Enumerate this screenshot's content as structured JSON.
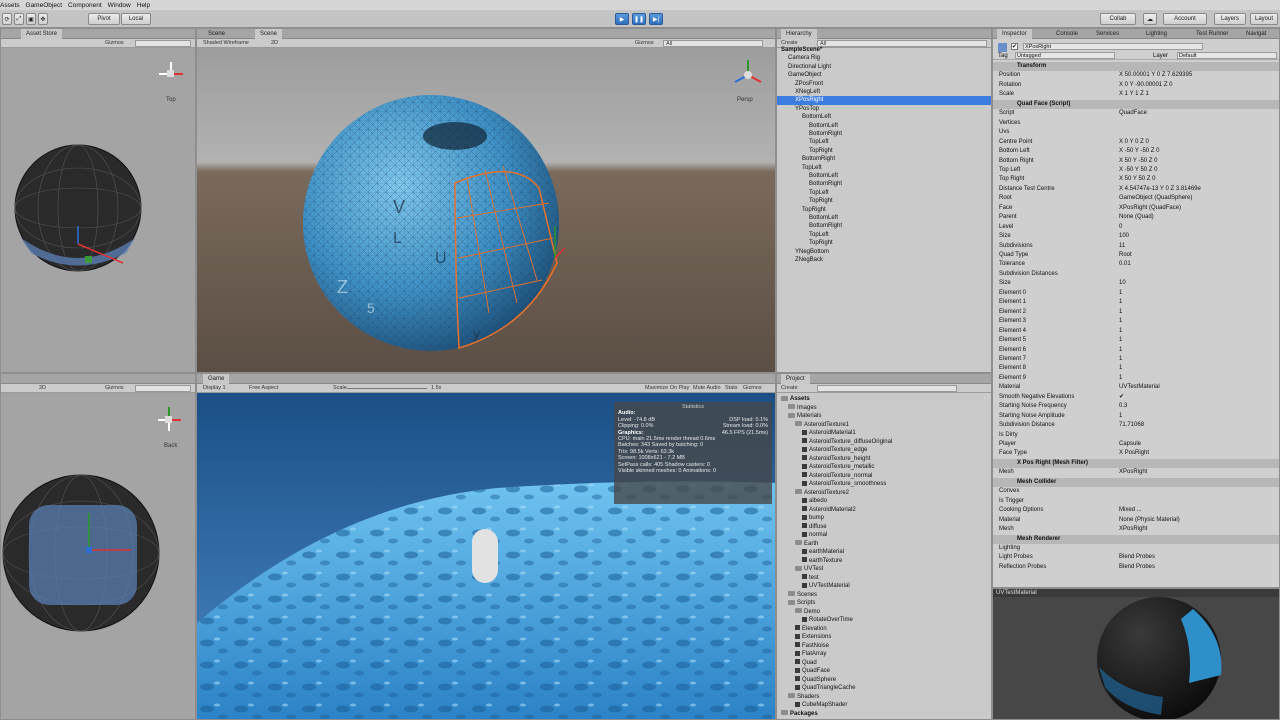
{
  "menu": [
    "Assets",
    "GameObject",
    "Component",
    "Window",
    "Help"
  ],
  "toolbar": {
    "pivot": "Pivot",
    "local": "Local",
    "collab": "Collab",
    "account": "Account",
    "layers": "Layers",
    "layout": "Layout"
  },
  "scene_left_top": {
    "tab": "Asset Store",
    "tab2": "",
    "gizmos": "Gizmos",
    "search": "",
    "orient": "Top"
  },
  "scene_main": {
    "tab1": "Scene",
    "tab2": "Scene",
    "shading": "Shaded Wireframe",
    "mode": "2D",
    "gizmos": "Gizmos",
    "search": "All",
    "persp": "Persp",
    "labels": [
      "V",
      "L",
      "U",
      "Z",
      "5",
      "y"
    ]
  },
  "scene_left_bottom": {
    "mode": "2D",
    "gizmos": "Gizmos",
    "orient": "Back"
  },
  "game": {
    "tab": "Game",
    "display": "Display 1",
    "aspect": "Free Aspect",
    "scale_label": "Scale",
    "scale_value": "1.5x",
    "maximize": "Maximize On Play",
    "mute": "Mute Audio",
    "stats": "Stats",
    "gizmos": "Gizmos"
  },
  "statistics": {
    "title": "Statistics",
    "audio_h": "Audio:",
    "level": "Level: -74.8 dB",
    "dsp": "DSP load: 0.1%",
    "clipping": "Clipping: 0.0%",
    "stream": "Stream load: 0.0%",
    "graphics_h": "Graphics:",
    "fps": "46.5 FPS (21.5ms)",
    "cpu": "CPU: main 21.5ms  render thread 0.6ms",
    "batches": "Batches: 343    Saved by batching: 0",
    "tris": "Tris: 98.5k     Verts: 63.3k",
    "screen": "Screen: 1008x621 - 7.2 MB",
    "setpass": "SetPass calls: 405   Shadow casters: 0",
    "skinned": "Visible skinned meshes: 0  Animations: 0"
  },
  "hierarchy": {
    "tab": "Hierarchy",
    "create": "Create",
    "search": "All",
    "items": [
      {
        "label": "SampleScene*",
        "indent": 0,
        "bold": true
      },
      {
        "label": "Camera Rig",
        "indent": 1
      },
      {
        "label": "Directional Light",
        "indent": 1
      },
      {
        "label": "GameObject",
        "indent": 1
      },
      {
        "label": "ZPosFront",
        "indent": 2
      },
      {
        "label": "XNegLeft",
        "indent": 2
      },
      {
        "label": "XPosRight",
        "indent": 2,
        "selected": true
      },
      {
        "label": "YPosTop",
        "indent": 2
      },
      {
        "label": "BottomLeft",
        "indent": 3
      },
      {
        "label": "BottomLeft",
        "indent": 4
      },
      {
        "label": "BottomRight",
        "indent": 4
      },
      {
        "label": "TopLeft",
        "indent": 4
      },
      {
        "label": "TopRight",
        "indent": 4
      },
      {
        "label": "BottomRight",
        "indent": 3
      },
      {
        "label": "TopLeft",
        "indent": 3
      },
      {
        "label": "BottomLeft",
        "indent": 4
      },
      {
        "label": "BottomRight",
        "indent": 4
      },
      {
        "label": "TopLeft",
        "indent": 4
      },
      {
        "label": "TopRight",
        "indent": 4
      },
      {
        "label": "TopRight",
        "indent": 3
      },
      {
        "label": "BottomLeft",
        "indent": 4
      },
      {
        "label": "BottomRight",
        "indent": 4
      },
      {
        "label": "TopLeft",
        "indent": 4
      },
      {
        "label": "TopRight",
        "indent": 4
      },
      {
        "label": "YNegBottom",
        "indent": 2
      },
      {
        "label": "ZNegBack",
        "indent": 2
      }
    ]
  },
  "project": {
    "tab": "Project",
    "create": "Create",
    "items": [
      {
        "label": "Assets",
        "indent": 0,
        "folder": true,
        "bold": true
      },
      {
        "label": "Images",
        "indent": 1,
        "folder": true
      },
      {
        "label": "Materials",
        "indent": 1,
        "folder": true
      },
      {
        "label": "AsteroidTexture1",
        "indent": 2,
        "folder": true
      },
      {
        "label": "AsteroidMaterial1",
        "indent": 3
      },
      {
        "label": "AsteroidTexture_diffuseOriginal",
        "indent": 3
      },
      {
        "label": "AsteroidTexture_edge",
        "indent": 3
      },
      {
        "label": "AsteroidTexture_height",
        "indent": 3
      },
      {
        "label": "AsteroidTexture_metallic",
        "indent": 3
      },
      {
        "label": "AsteroidTexture_normal",
        "indent": 3
      },
      {
        "label": "AsteroidTexture_smoothness",
        "indent": 3
      },
      {
        "label": "AsteroidTexture2",
        "indent": 2,
        "folder": true
      },
      {
        "label": "albedo",
        "indent": 3
      },
      {
        "label": "AsteroidMaterial2",
        "indent": 3
      },
      {
        "label": "bump",
        "indent": 3
      },
      {
        "label": "diffuse",
        "indent": 3
      },
      {
        "label": "normal",
        "indent": 3
      },
      {
        "label": "Earth",
        "indent": 2,
        "folder": true
      },
      {
        "label": "earthMaterial",
        "indent": 3
      },
      {
        "label": "earthTexture",
        "indent": 3
      },
      {
        "label": "UVTest",
        "indent": 2,
        "folder": true
      },
      {
        "label": "test",
        "indent": 3
      },
      {
        "label": "UVTestMaterial",
        "indent": 3
      },
      {
        "label": "Scenes",
        "indent": 1,
        "folder": true
      },
      {
        "label": "Scripts",
        "indent": 1,
        "folder": true
      },
      {
        "label": "Demo",
        "indent": 2,
        "folder": true
      },
      {
        "label": "RotateOverTime",
        "indent": 3
      },
      {
        "label": "Elevation",
        "indent": 2
      },
      {
        "label": "Extensions",
        "indent": 2
      },
      {
        "label": "FastNoise",
        "indent": 2
      },
      {
        "label": "FlatArray",
        "indent": 2
      },
      {
        "label": "Quad",
        "indent": 2
      },
      {
        "label": "QuadFace",
        "indent": 2
      },
      {
        "label": "QuadSphere",
        "indent": 2
      },
      {
        "label": "QuadTriangleCache",
        "indent": 2
      },
      {
        "label": "Shaders",
        "indent": 1,
        "folder": true
      },
      {
        "label": "CubeMapShader",
        "indent": 2
      },
      {
        "label": "Packages",
        "indent": 0,
        "folder": true,
        "bold": true
      }
    ]
  },
  "inspector": {
    "tab": "Inspector",
    "tab_console": "Console",
    "tab_services": "Services",
    "tab_lighting": "Lighting",
    "tab_runner": "Test Runner",
    "tab_nav": "Navigat",
    "object_name": "XPosRight",
    "tag_label": "Tag",
    "tag_value": "Untagged",
    "layer_label": "Layer",
    "layer_value": "Default",
    "rows": [
      {
        "kind": "header",
        "label": "Transform"
      },
      {
        "label": "Position",
        "value": "X 50.00001   Y 0   Z 7.629395"
      },
      {
        "label": "Rotation",
        "value": "X 0   Y -90.00001   Z 0"
      },
      {
        "label": "Scale",
        "value": "X 1   Y 1   Z 1"
      },
      {
        "kind": "header",
        "label": "Quad Face (Script)"
      },
      {
        "label": "Script",
        "value": "QuadFace"
      },
      {
        "label": "Vertices",
        "value": ""
      },
      {
        "label": "Uvs",
        "value": ""
      },
      {
        "label": "Centre Point",
        "value": "X 0   Y 0   Z 0"
      },
      {
        "label": "Bottom Left",
        "value": "X -50   Y -50   Z 0"
      },
      {
        "label": "Bottom Right",
        "value": "X 50   Y -50   Z 0"
      },
      {
        "label": "Top Left",
        "value": "X -50   Y 50   Z 0"
      },
      {
        "label": "Top Right",
        "value": "X 50   Y 50   Z 0"
      },
      {
        "label": "Distance Test Centre",
        "value": "X 4.54747e-13   Y 0   Z 3.81469e"
      },
      {
        "label": "Root",
        "value": "GameObject (QuadSphere)"
      },
      {
        "label": "Face",
        "value": "XPosRight (QuadFace)"
      },
      {
        "label": "Parent",
        "value": "None (Quad)"
      },
      {
        "label": "Level",
        "value": "0"
      },
      {
        "label": "Size",
        "value": "100"
      },
      {
        "label": "Subdivisions",
        "value": "11"
      },
      {
        "label": "Quad Type",
        "value": "Root"
      },
      {
        "label": "Tolerance",
        "value": "0.01"
      },
      {
        "label": "Subdivision Distances",
        "value": ""
      },
      {
        "label": "Size",
        "value": "10"
      },
      {
        "label": "Element 0",
        "value": "1"
      },
      {
        "label": "Element 1",
        "value": "1"
      },
      {
        "label": "Element 2",
        "value": "1"
      },
      {
        "label": "Element 3",
        "value": "1"
      },
      {
        "label": "Element 4",
        "value": "1"
      },
      {
        "label": "Element 5",
        "value": "1"
      },
      {
        "label": "Element 6",
        "value": "1"
      },
      {
        "label": "Element 7",
        "value": "1"
      },
      {
        "label": "Element 8",
        "value": "1"
      },
      {
        "label": "Element 9",
        "value": "1"
      },
      {
        "label": "Material",
        "value": "UVTestMaterial"
      },
      {
        "label": "Smooth Negative Elevations",
        "value": "✔"
      },
      {
        "label": "Starting Noise Frequency",
        "value": "0.3"
      },
      {
        "label": "Starting Noise Amplitude",
        "value": "1"
      },
      {
        "label": "Subdivision Distance",
        "value": "71.71068"
      },
      {
        "label": "Is Dirty",
        "value": ""
      },
      {
        "label": "Player",
        "value": "Capsule"
      },
      {
        "label": "Face Type",
        "value": "X PosRight"
      },
      {
        "kind": "header",
        "label": "X Pos Right (Mesh Filter)"
      },
      {
        "label": "Mesh",
        "value": "XPosRight"
      },
      {
        "kind": "header",
        "label": "Mesh Collider"
      },
      {
        "label": "Convex",
        "value": ""
      },
      {
        "label": "Is Trigger",
        "value": ""
      },
      {
        "label": "Cooking Options",
        "value": "Mixed ..."
      },
      {
        "label": "Material",
        "value": "None (Physic Material)"
      },
      {
        "label": "Mesh",
        "value": "XPosRight"
      },
      {
        "kind": "header",
        "label": "Mesh Renderer"
      },
      {
        "label": "Lighting",
        "value": ""
      },
      {
        "label": "Light Probes",
        "value": "Blend Probes"
      },
      {
        "label": "Reflection Probes",
        "value": "Blend Probes"
      }
    ],
    "preview_title": "UVTestMaterial"
  }
}
